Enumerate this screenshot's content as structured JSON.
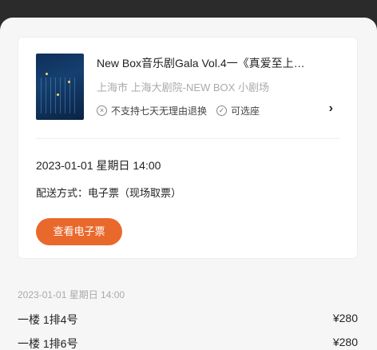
{
  "show": {
    "title": "New Box音乐剧Gala Vol.4一《真爱至上…",
    "venue": "上海市 上海大剧院-NEW BOX 小剧场",
    "policies": [
      {
        "icon": "x-circle-icon",
        "label": "不支持七天无理由退换"
      },
      {
        "icon": "check-circle-icon",
        "label": "可选座"
      }
    ]
  },
  "order": {
    "datetime": "2023-01-01 星期日 14:00",
    "delivery": "配送方式：电子票（现场取票）",
    "eticket_button": "查看电子票"
  },
  "session": {
    "date": "2023-01-01 星期日 14:00",
    "tickets": [
      {
        "seat": "一楼   1排4号",
        "price": "¥280"
      },
      {
        "seat": "一楼   1排6号",
        "price": "¥280"
      }
    ]
  },
  "colors": {
    "accent": "#e9692c",
    "muted": "#aaaaaa"
  }
}
